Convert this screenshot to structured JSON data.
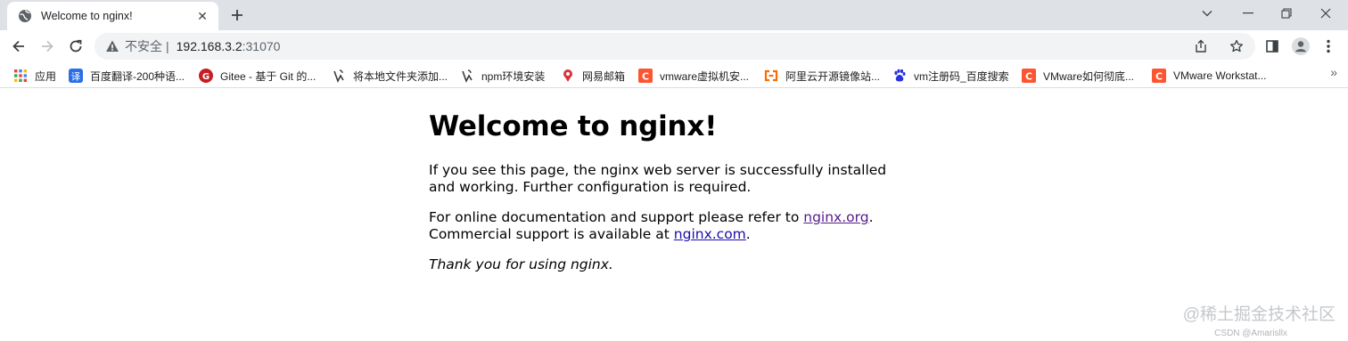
{
  "tab": {
    "title": "Welcome to nginx!",
    "close": "✕",
    "new": "+"
  },
  "window": {
    "minimize": "—",
    "restore": "❐",
    "close": "✕",
    "tabsearch": "⌄"
  },
  "omnibox": {
    "insecure": "不安全",
    "sep": "|",
    "host": "192.168.3.2",
    "port": ":31070"
  },
  "bookmarks": [
    {
      "label": "应用",
      "icon": "apps-grid-icon",
      "color": "#4285f4"
    },
    {
      "label": "百度翻译-200种语...",
      "icon": "baidu-translate-icon",
      "color": "#2b6ee8"
    },
    {
      "label": "Gitee - 基于 Git 的...",
      "icon": "gitee-icon",
      "color": "#c71d23"
    },
    {
      "label": "将本地文件夹添加...",
      "icon": "jianshu-icon",
      "color": "#3a3a3a"
    },
    {
      "label": "npm环境安装",
      "icon": "jianshu-icon",
      "color": "#3a3a3a"
    },
    {
      "label": "网易邮箱",
      "icon": "netease-mail-icon",
      "color": "#d8333d"
    },
    {
      "label": "vmware虚拟机安...",
      "icon": "csdn-icon",
      "color": "#fc5531"
    },
    {
      "label": "阿里云开源镜像站...",
      "icon": "aliyun-icon",
      "color": "#ff6a00"
    },
    {
      "label": "vm注册码_百度搜索",
      "icon": "baidu-paw-icon",
      "color": "#2932e1"
    },
    {
      "label": "VMware如何彻底...",
      "icon": "csdn-icon",
      "color": "#fc5531"
    },
    {
      "label": "VMware Workstat...",
      "icon": "csdn-icon",
      "color": "#fc5531"
    }
  ],
  "bookmarks_more": "»",
  "page": {
    "heading": "Welcome to nginx!",
    "p1": "If you see this page, the nginx web server is successfully installed and working. Further configuration is required.",
    "p2_before": "For online documentation and support please refer to ",
    "p2_link1": "nginx.org",
    "p2_mid": ".",
    "p2_line2": "Commercial support is available at ",
    "p2_link2": "nginx.com",
    "p2_end": ".",
    "p3": "Thank you for using nginx."
  },
  "watermark": {
    "main": "@稀土掘金技术社区",
    "sub": "CSDN @Amarisllx"
  }
}
